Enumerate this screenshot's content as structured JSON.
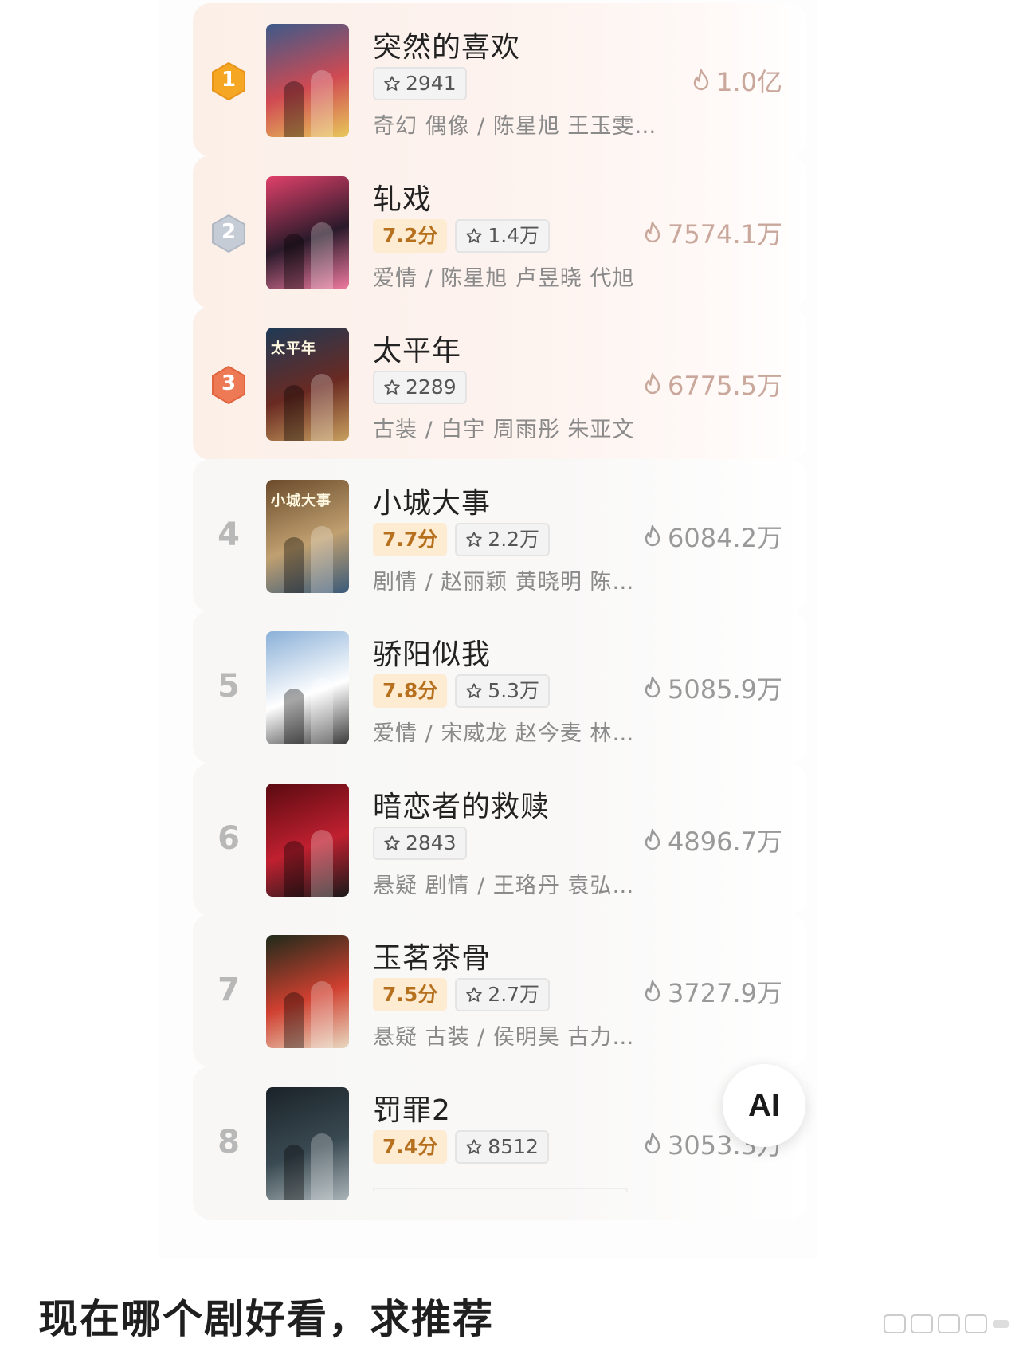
{
  "list": [
    {
      "rank": "1",
      "title": "突然的喜欢",
      "score": "",
      "favorites": "2941",
      "meta": "奇幻 偶像 / 陈星旭 王玉雯…",
      "heat": "1.0亿",
      "poster_text": "",
      "poster_colors": [
        "#3d5a8a",
        "#d04a52",
        "#e8c85a"
      ]
    },
    {
      "rank": "2",
      "title": "轧戏",
      "score": "7.2分",
      "favorites": "1.4万",
      "meta": "爱情 / 陈星旭 卢昱晓 代旭",
      "heat": "7574.1万",
      "poster_text": "",
      "poster_colors": [
        "#e0406a",
        "#2a1a2a",
        "#f07aa0"
      ]
    },
    {
      "rank": "3",
      "title": "太平年",
      "score": "",
      "favorites": "2289",
      "meta": "古装 / 白宇 周雨彤 朱亚文",
      "heat": "6775.5万",
      "poster_text": "太平年",
      "poster_colors": [
        "#1e3a56",
        "#6a2a22",
        "#c8a060"
      ]
    },
    {
      "rank": "4",
      "title": "小城大事",
      "score": "7.7分",
      "favorites": "2.2万",
      "meta": "剧情 / 赵丽颖 黄晓明 陈…",
      "heat": "6084.2万",
      "poster_text": "小城大事",
      "poster_colors": [
        "#6a4a2a",
        "#c0a070",
        "#3a5a7a"
      ]
    },
    {
      "rank": "5",
      "title": "骄阳似我",
      "score": "7.8分",
      "favorites": "5.3万",
      "meta": "爱情 / 宋威龙 赵今麦 林…",
      "heat": "5085.9万",
      "poster_text": "",
      "poster_colors": [
        "#8ab0d8",
        "#ffffff",
        "#3a3a3a"
      ]
    },
    {
      "rank": "6",
      "title": "暗恋者的救赎",
      "score": "",
      "favorites": "2843",
      "meta": "悬疑 剧情 / 王珞丹 袁弘…",
      "heat": "4896.7万",
      "poster_text": "",
      "poster_colors": [
        "#5a0a10",
        "#c02030",
        "#1a1a1a"
      ]
    },
    {
      "rank": "7",
      "title": "玉茗茶骨",
      "score": "7.5分",
      "favorites": "2.7万",
      "meta": "悬疑 古装 / 侯明昊 古力…",
      "heat": "3727.9万",
      "poster_text": "",
      "poster_colors": [
        "#1e2a1a",
        "#d04030",
        "#e8d8c0"
      ]
    },
    {
      "rank": "8",
      "title": "罚罪2",
      "score": "7.4分",
      "favorites": "8512",
      "meta": "",
      "heat": "3053.3万",
      "poster_text": "",
      "poster_colors": [
        "#1a2228",
        "#3a4a52",
        "#aab4b8"
      ]
    }
  ],
  "ai_label": "AI",
  "caption": "现在哪个剧好看，求推荐",
  "colors": {
    "gold": "#f5a623",
    "silver": "#c6ccd6",
    "bronze": "#ee7a55",
    "score_bg": "#fdebd2",
    "score_text": "#b6701e"
  }
}
